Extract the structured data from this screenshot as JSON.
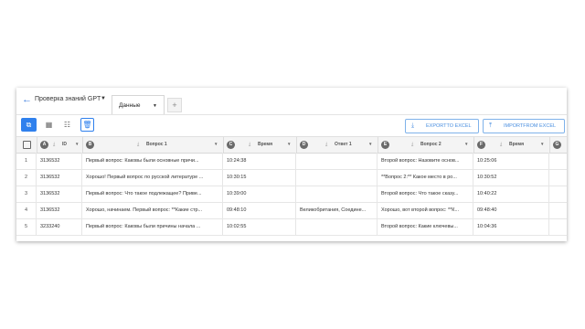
{
  "header": {
    "back_icon": "arrow-left-icon",
    "title": "Проверка знаний GPT",
    "sheet_tab": "Данные",
    "add_tab": "+"
  },
  "toolbar": {
    "export_label": "EXPORTTO EXCEL",
    "import_label": "IMPORTFROM EXCEL",
    "accent": "#2f80ed"
  },
  "columns": [
    {
      "letter": "A",
      "name": "ID"
    },
    {
      "letter": "B",
      "name": "Вопрос 1"
    },
    {
      "letter": "C",
      "name": "Время"
    },
    {
      "letter": "D",
      "name": "Ответ 1"
    },
    {
      "letter": "E",
      "name": "Вопрос 2"
    },
    {
      "letter": "F",
      "name": "Время"
    },
    {
      "letter": "G",
      "name": ""
    }
  ],
  "rows": [
    {
      "n": "1",
      "id": "3136532",
      "q1": "Первый вопрос: Каковы были основные причи...",
      "t1": "10:24:38",
      "a1": "",
      "q2": "Второй вопрос: Назовите основ...",
      "t2": "10:25:06"
    },
    {
      "n": "2",
      "id": "3136532",
      "q1": "Хорошо! Первый вопрос по русской литературе ...",
      "t1": "10:30:15",
      "a1": "",
      "q2": "**Вопрос 2:** Какое место в ро...",
      "t2": "10:30:52"
    },
    {
      "n": "3",
      "id": "3136532",
      "q1": "Первый вопрос: Что такое подлежащее? Приве...",
      "t1": "10:39:00",
      "a1": "",
      "q2": "Второй вопрос: Что такое сказу...",
      "t2": "10:40:22"
    },
    {
      "n": "4",
      "id": "3136532",
      "q1": "Хорошо, начинаем. Первый вопрос: **Какие стр...",
      "t1": "09:48:10",
      "a1": "Великобритания, Соедине...",
      "q2": "Хорошо, вот второй вопрос: **К...",
      "t2": "09:48:40"
    },
    {
      "n": "5",
      "id": "3233240",
      "q1": "Первый вопрос: Каковы были причины начала ...",
      "t1": "10:02:55",
      "a1": "",
      "q2": "Второй вопрос: Какие ключевы...",
      "t2": "10:04:36"
    }
  ]
}
